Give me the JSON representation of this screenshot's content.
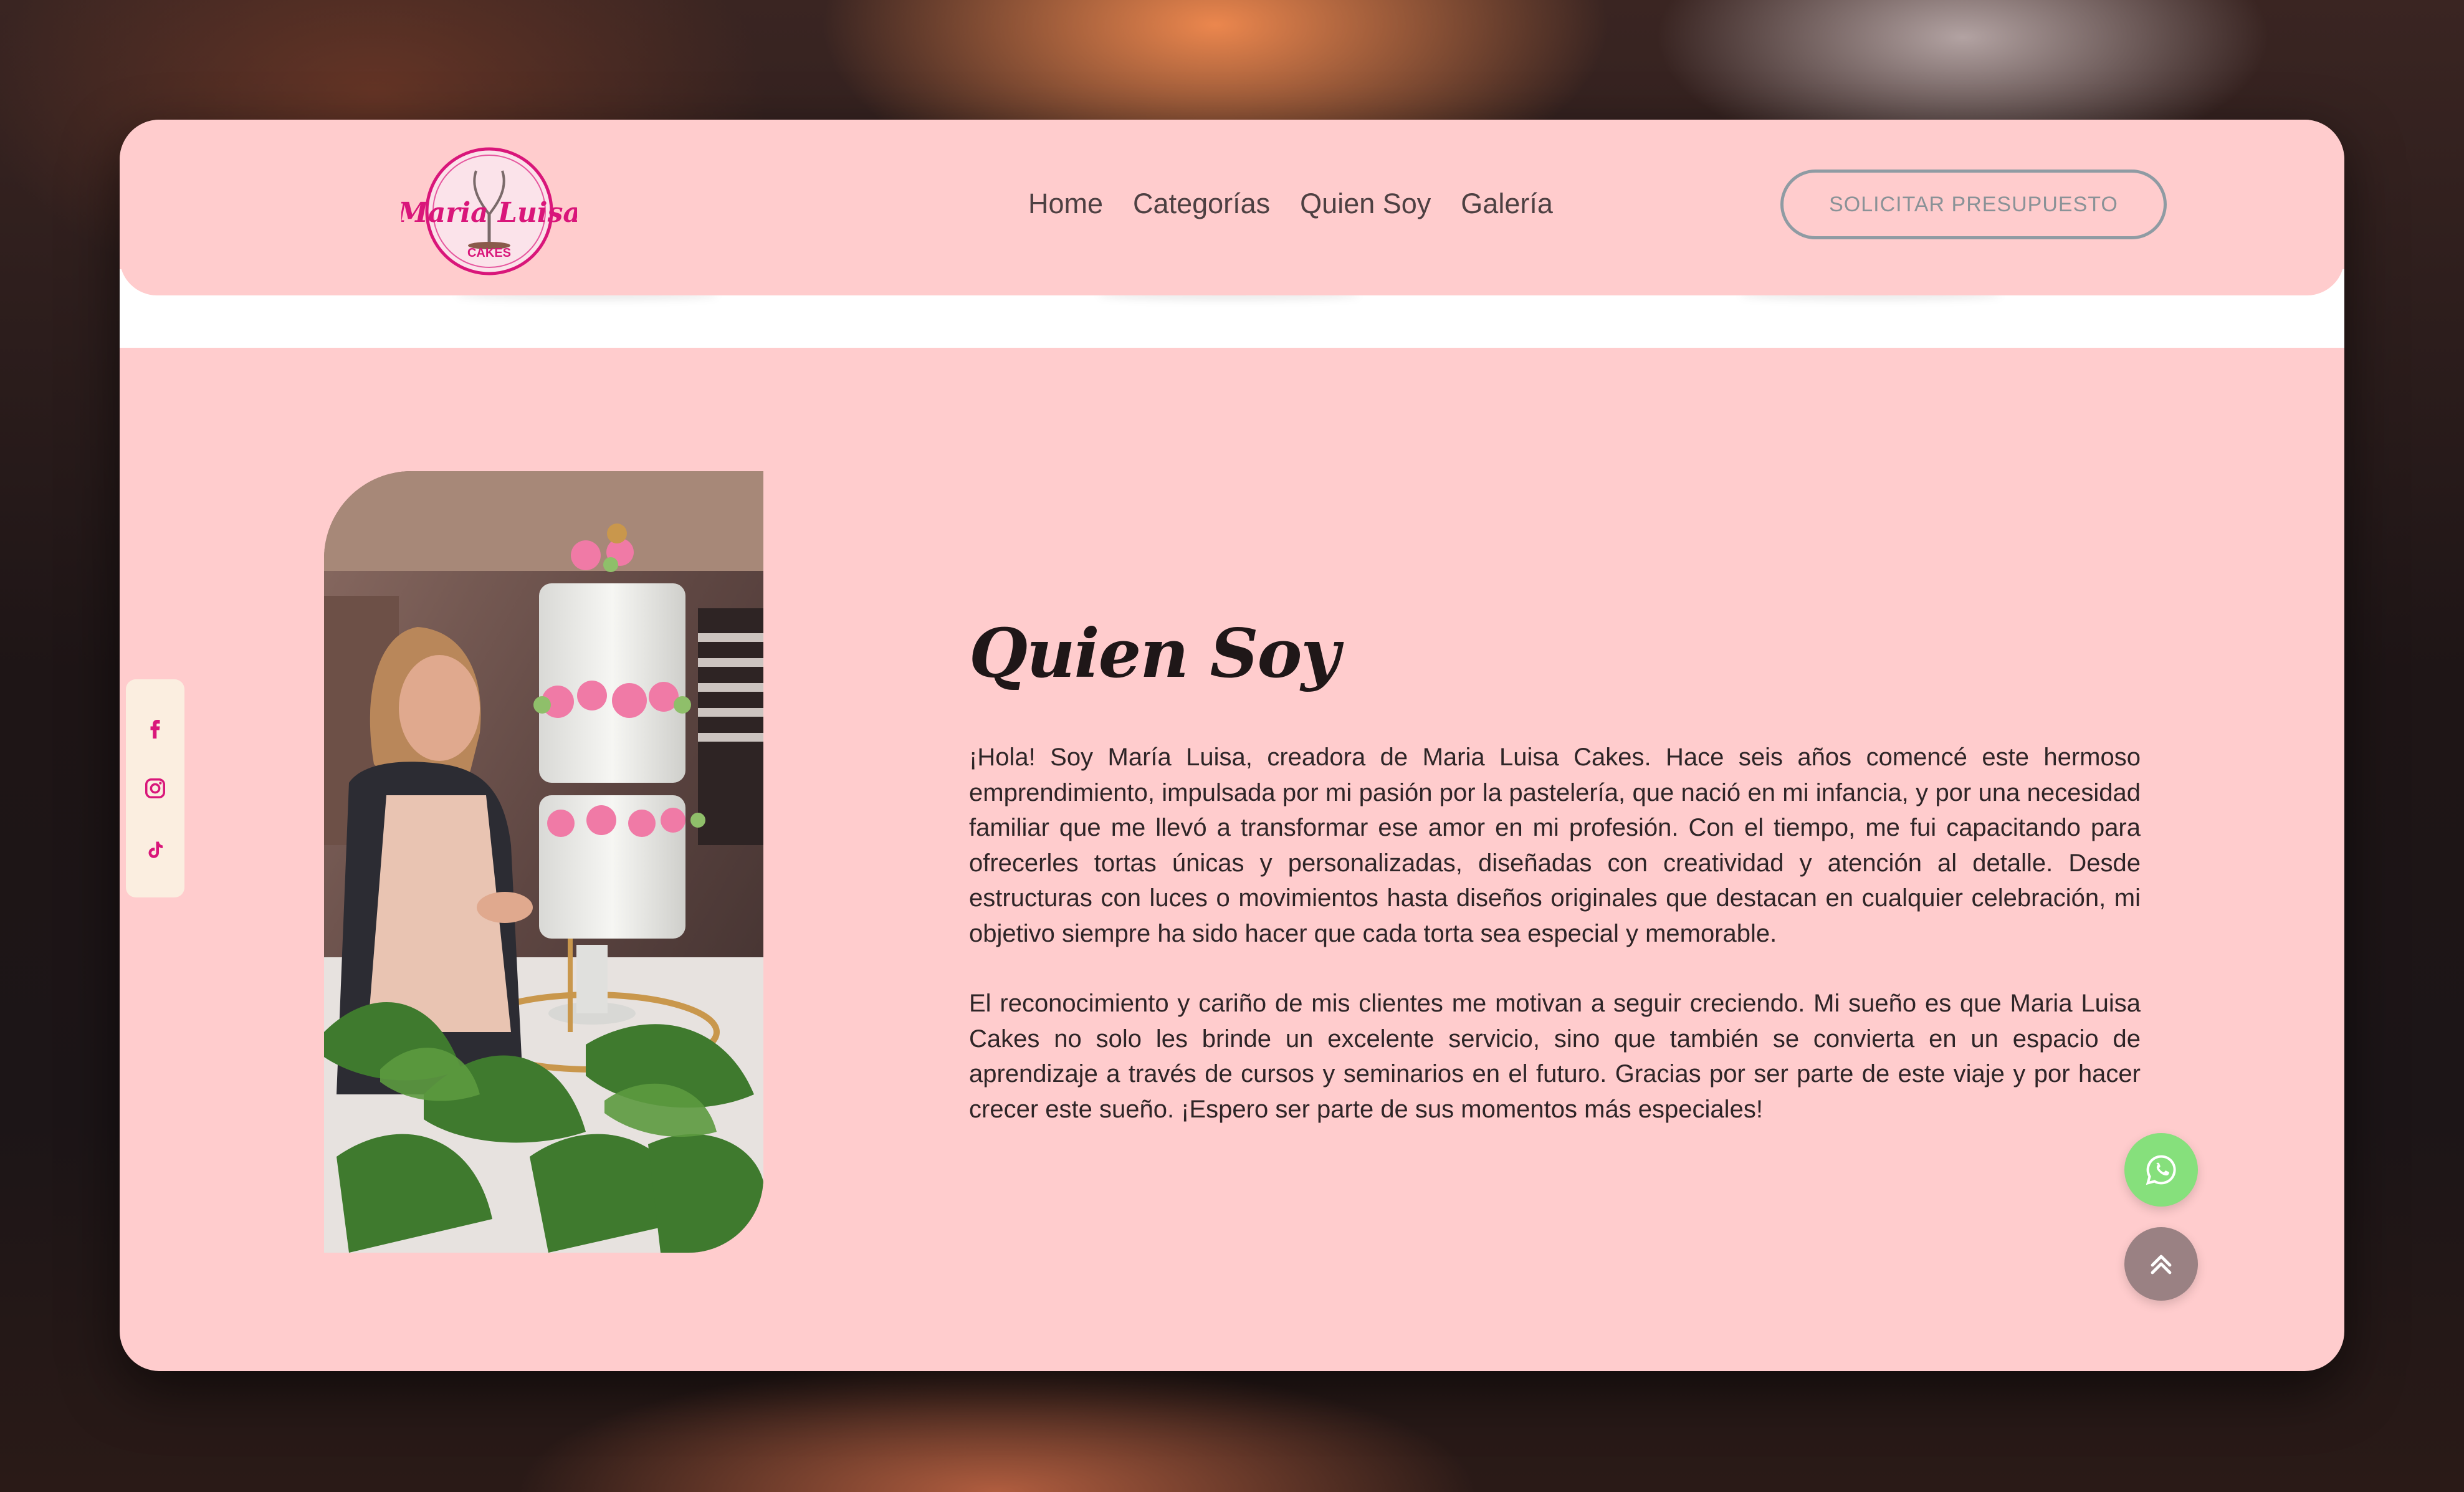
{
  "brand": {
    "logo_line1": "Maria",
    "logo_line2": "Luisa",
    "logo_sub": "CAKES",
    "accent_color": "#d9167a"
  },
  "nav": {
    "items": [
      {
        "label": "Home"
      },
      {
        "label": "Categorías"
      },
      {
        "label": "Quien Soy"
      },
      {
        "label": "Galería"
      }
    ],
    "cta_label": "SOLICITAR PRESUPUESTO"
  },
  "social": {
    "icons": [
      "facebook-icon",
      "instagram-icon",
      "tiktok-icon"
    ],
    "color": "#d9167a"
  },
  "about": {
    "title": "Quien Soy",
    "paragraphs": [
      "¡Hola! Soy María Luisa, creadora de Maria Luisa Cakes. Hace seis años comencé este hermoso emprendimiento, impulsada por mi pasión por la pastelería, que nació en mi infancia, y por una necesidad familiar que me llevó a transformar ese amor en mi profesión. Con el tiempo, me fui capacitando para ofrecerles tortas únicas y personalizadas, diseñadas con creatividad y atención al detalle. Desde estructuras con luces o movimientos hasta diseños originales que destacan en cualquier celebración, mi objetivo siempre ha sido hacer que cada torta sea especial y memorable.",
      "El reconocimiento y cariño de mis clientes me motivan a seguir creciendo. Mi sueño es que Maria Luisa Cakes no solo les brinde un excelente servicio, sino que también se convierta en un espacio de aprendizaje a través de cursos y seminarios en el futuro. Gracias por ser parte de este viaje y por hacer crecer este sueño. ¡Espero ser parte de sus momentos más especiales!"
    ]
  },
  "floating": {
    "whatsapp_icon": "whatsapp-icon",
    "scroll_top_icon": "double-chevron-up-icon",
    "whatsapp_color": "#86e07c",
    "scroll_top_color": "#9a8183"
  },
  "colors": {
    "page_bg": "#ffcccd",
    "text": "#2e2527"
  }
}
